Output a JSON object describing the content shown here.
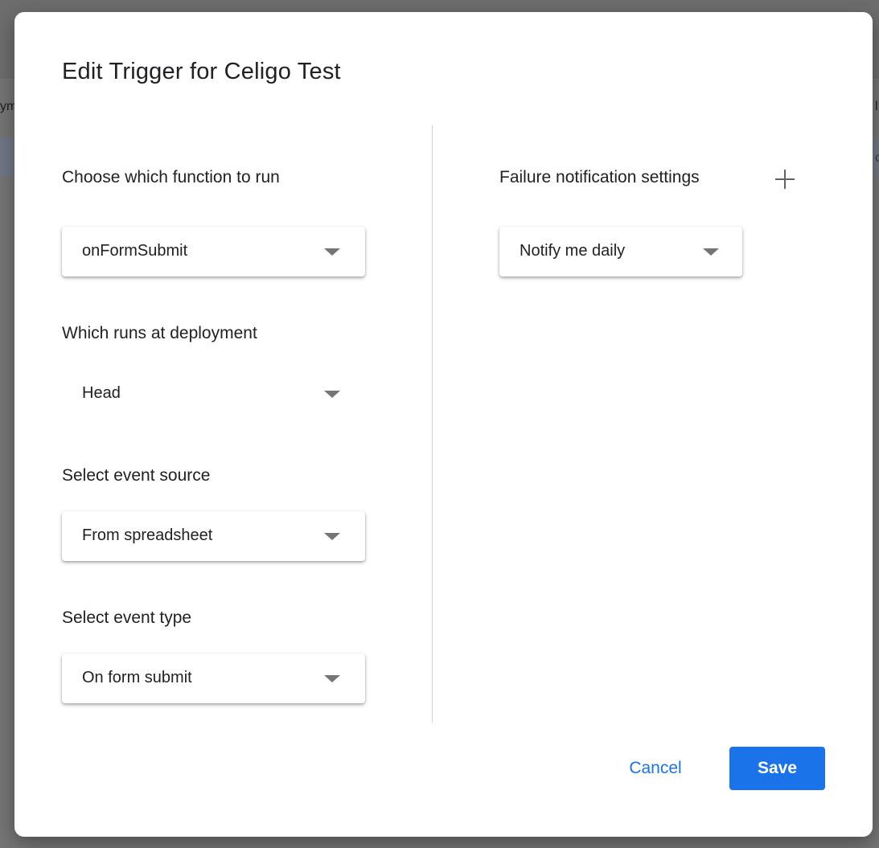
{
  "background": {
    "left_fragment": "ym",
    "right_fragment": "l",
    "right_fragment_2": "c"
  },
  "dialog": {
    "title": "Edit Trigger for Celigo Test",
    "function": {
      "label": "Choose which function to run",
      "value": "onFormSubmit"
    },
    "deployment": {
      "label": "Which runs at deployment",
      "value": "Head"
    },
    "event_source": {
      "label": "Select event source",
      "value": "From spreadsheet"
    },
    "event_type": {
      "label": "Select event type",
      "value": "On form submit"
    },
    "failure_notification": {
      "label": "Failure notification settings",
      "value": "Notify me daily"
    },
    "buttons": {
      "cancel": "Cancel",
      "save": "Save"
    },
    "colors": {
      "accent": "#1a73e8",
      "overlay": "#757575",
      "text": "#202124"
    }
  }
}
